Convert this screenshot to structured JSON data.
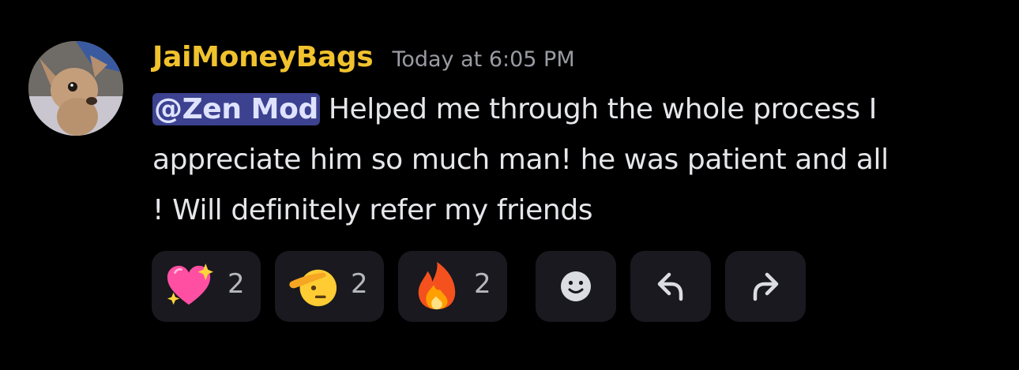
{
  "message": {
    "author": "JaiMoneyBags",
    "timestamp": "Today at 6:05 PM",
    "mention": "@Zen Mod",
    "body_line1": "Helped me through the whole process I",
    "body_line2": "appreciate him so much man! he was patient and all",
    "body_line3": "! Will definitely refer my friends"
  },
  "reactions": [
    {
      "emoji": "sparkling-heart-icon",
      "count": "2"
    },
    {
      "emoji": "saluting-face-icon",
      "count": "2"
    },
    {
      "emoji": "fire-icon",
      "count": "2"
    }
  ],
  "actions": [
    {
      "icon": "add-reaction-icon"
    },
    {
      "icon": "reply-icon"
    },
    {
      "icon": "forward-icon"
    }
  ],
  "colors": {
    "background": "#000000",
    "username": "#f0c22e",
    "timestamp": "#9a9ba3",
    "text": "#e6e7eb",
    "mention_bg": "#3c4290",
    "pill_bg": "#19191f"
  }
}
